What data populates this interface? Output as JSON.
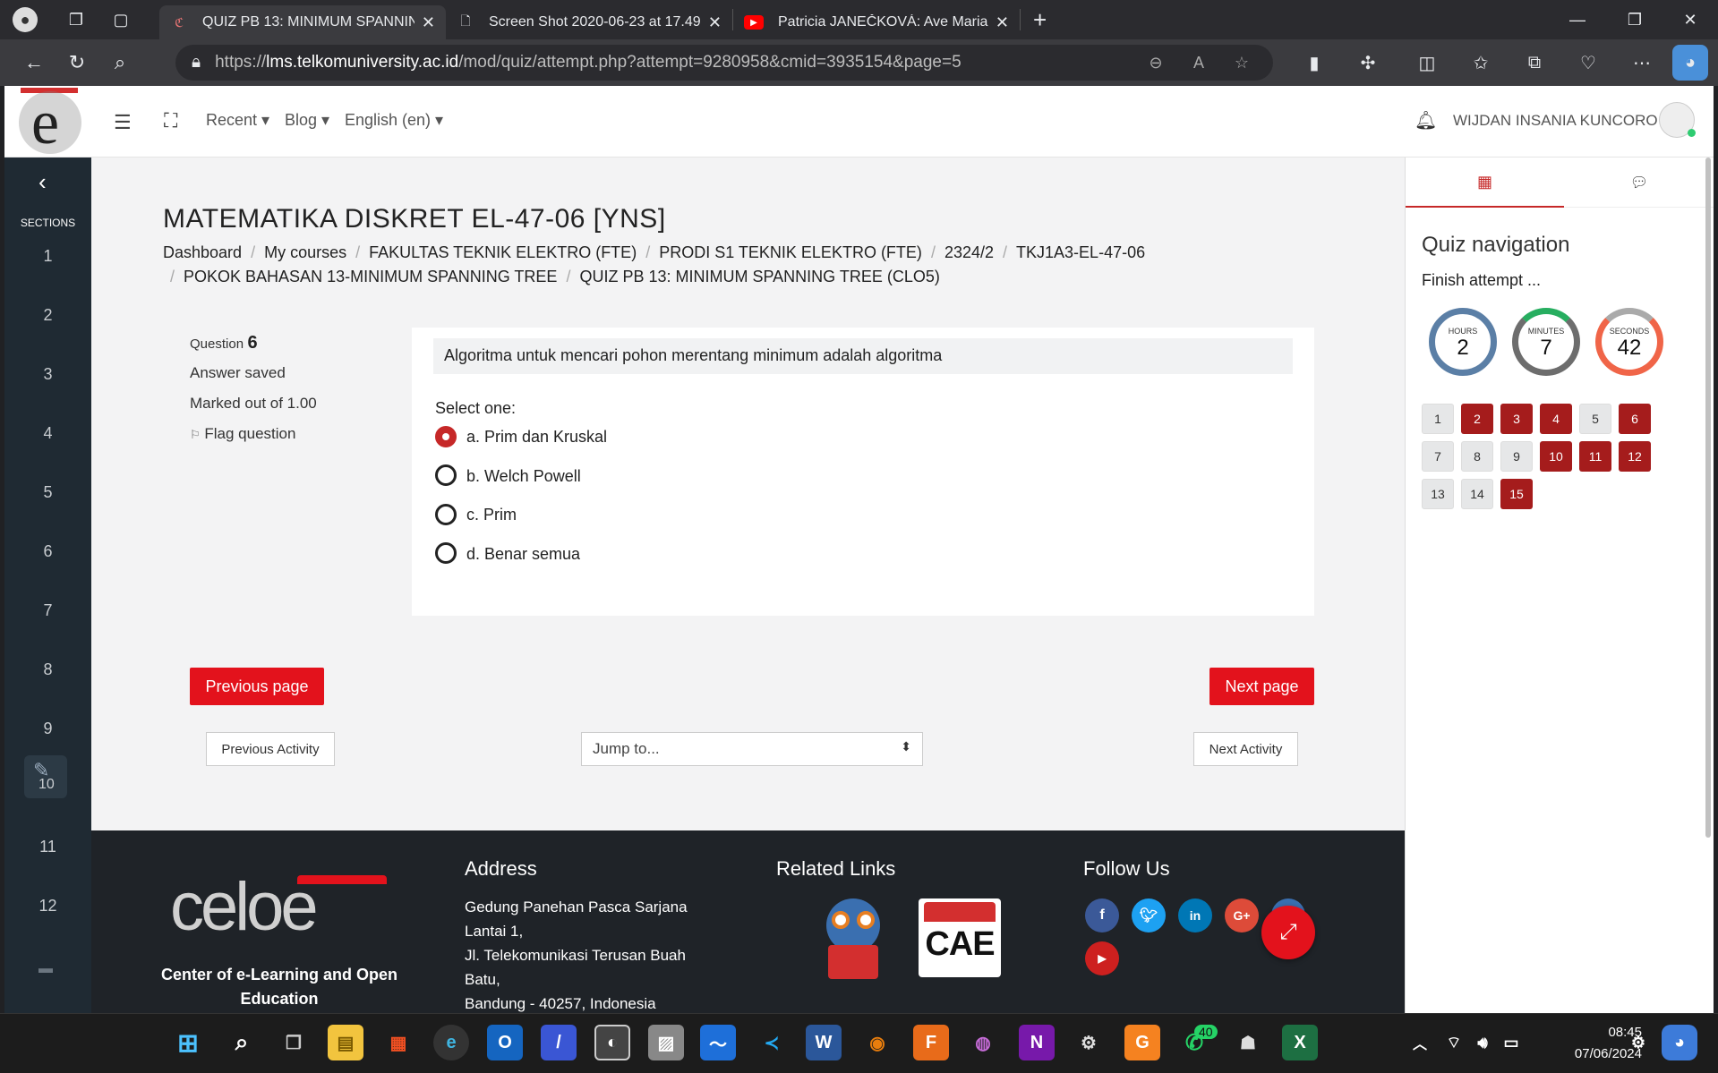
{
  "browser": {
    "tabs": [
      {
        "title": "QUIZ PB 13: MINIMUM SPANNIN",
        "active": true
      },
      {
        "title": "Screen Shot 2020-06-23 at 17.49",
        "active": false
      },
      {
        "title": "Patricia JANEČKOVÁ: Ave Maria (",
        "active": false
      }
    ],
    "url_prefix": "https://",
    "url_host": "lms.telkomuniversity.ac.id",
    "url_path": "/mod/quiz/attempt.php?attempt=9280958&cmid=3935154&page=5"
  },
  "navbar": {
    "menu": [
      "Recent",
      "Blog",
      "English (en)"
    ],
    "user_name": "WIJDAN INSANIA KUNCORO"
  },
  "sidebar": {
    "heading": "SECTIONS",
    "items": [
      "1",
      "2",
      "3",
      "4",
      "5",
      "6",
      "7",
      "8",
      "9",
      "10",
      "11",
      "12"
    ]
  },
  "course": {
    "title": "MATEMATIKA DISKRET EL-47-06 [YNS]",
    "breadcrumb_row1": [
      "Dashboard",
      "My courses",
      "FAKULTAS TEKNIK ELEKTRO (FTE)",
      "PRODI S1 TEKNIK ELEKTRO (FTE)",
      "2324/2",
      "TKJ1A3-EL-47-06"
    ],
    "breadcrumb_row2": [
      "POKOK BAHASAN 13-MINIMUM SPANNING TREE",
      "QUIZ PB 13: MINIMUM SPANNING TREE (CLO5)"
    ]
  },
  "question": {
    "label": "Question",
    "number": "6",
    "state": "Answer saved",
    "marks": "Marked out of 1.00",
    "flag": "Flag question",
    "text": "Algoritma untuk mencari pohon merentang minimum adalah algoritma",
    "prompt": "Select one:",
    "options": [
      {
        "label": "a. Prim dan Kruskal",
        "selected": true
      },
      {
        "label": "b. Welch Powell",
        "selected": false
      },
      {
        "label": "c. Prim",
        "selected": false
      },
      {
        "label": "d. Benar semua",
        "selected": false
      }
    ]
  },
  "buttons": {
    "previous_page": "Previous page",
    "next_page": "Next page",
    "previous_activity": "Previous Activity",
    "next_activity": "Next Activity",
    "jump_to": "Jump to..."
  },
  "quiz_nav": {
    "title": "Quiz navigation",
    "finish": "Finish attempt ...",
    "timers": [
      {
        "label": "HOURS",
        "value": "2",
        "color": "#5b7fa6"
      },
      {
        "label": "MINUTES",
        "value": "7",
        "color": "#27ae60"
      },
      {
        "label": "SECONDS",
        "value": "42",
        "color": "#f06548"
      }
    ],
    "questions": [
      {
        "n": "1",
        "answered": false
      },
      {
        "n": "2",
        "answered": true
      },
      {
        "n": "3",
        "answered": true
      },
      {
        "n": "4",
        "answered": true
      },
      {
        "n": "5",
        "answered": false
      },
      {
        "n": "6",
        "answered": true
      },
      {
        "n": "7",
        "answered": false
      },
      {
        "n": "8",
        "answered": false
      },
      {
        "n": "9",
        "answered": false
      },
      {
        "n": "10",
        "answered": true
      },
      {
        "n": "11",
        "answered": true
      },
      {
        "n": "12",
        "answered": true
      },
      {
        "n": "13",
        "answered": false
      },
      {
        "n": "14",
        "answered": false
      },
      {
        "n": "15",
        "answered": true
      }
    ]
  },
  "footer": {
    "org_name": "Center of e-Learning and Open Education",
    "address_title": "Address",
    "address_lines": [
      "Gedung Panehan Pasca Sarjana",
      "Lantai 1,",
      "Jl. Telekomunikasi Terusan Buah",
      "Batu,",
      "Bandung - 40257, Indonesia"
    ],
    "links_title": "Related Links",
    "follow_title": "Follow Us",
    "cae_logo_text": "CAE"
  },
  "taskbar": {
    "time": "08:45",
    "date": "07/06/2024",
    "whatsapp_badge": "40"
  },
  "colors": {
    "accent": "#e3121c",
    "answered": "#a51c1c",
    "sidebar": "#1f2a33",
    "footer": "#1f2328"
  }
}
